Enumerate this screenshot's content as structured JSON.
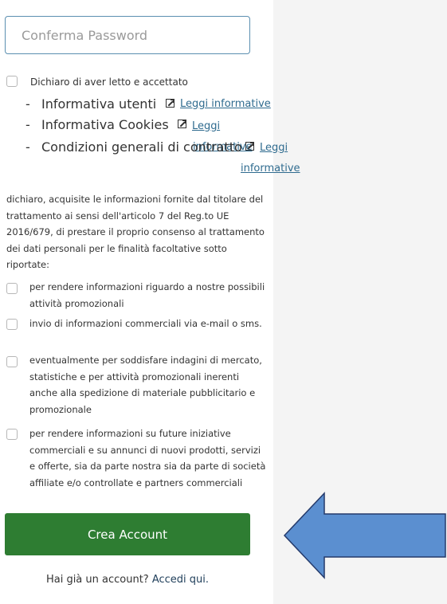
{
  "form": {
    "confirm_password_placeholder": "Conferma Password"
  },
  "declaration": {
    "intro": "Dichiaro di aver letto e accettato",
    "items": [
      {
        "dash": "-",
        "label": "Informativa utenti",
        "link": "Leggi informative"
      },
      {
        "dash": "-",
        "label": "Informativa Cookies",
        "link_line1": "Leggi",
        "link_line2": "informative"
      },
      {
        "dash": "-",
        "label": "Condizioni generali di contratto",
        "link_line1": "Leggi",
        "link_line2": "informative"
      }
    ]
  },
  "consent": {
    "paragraph": "dichiaro, acquisite le informazioni fornite dal titolare del trattamento ai sensi dell'articolo 7 del Reg.to UE 2016/679, di prestare il proprio consenso al trattamento dei dati personali per le finalità facoltative sotto riportate:",
    "options": [
      "per rendere informazioni riguardo a nostre possibili attività promozionali",
      "invio di informazioni commerciali via e-mail o sms.",
      "eventualmente per soddisfare indagini di mercato, statistiche e per attività promozionali inerenti anche alla spedizione di materiale pubblicitario e promozionale",
      "per rendere informazioni su future iniziative commerciali e su annunci di nuovi prodotti, servizi e offerte, sia da parte nostra sia da parte di società affiliate e/o controllate e partners commerciali"
    ]
  },
  "actions": {
    "create_account": "Crea Account",
    "have_account": "Hai già un account?",
    "login_link": "Accedi qui."
  },
  "colors": {
    "primary_green": "#2e7d32",
    "arrow_blue": "#5b8fd0",
    "link_blue": "#2f6b8f"
  }
}
